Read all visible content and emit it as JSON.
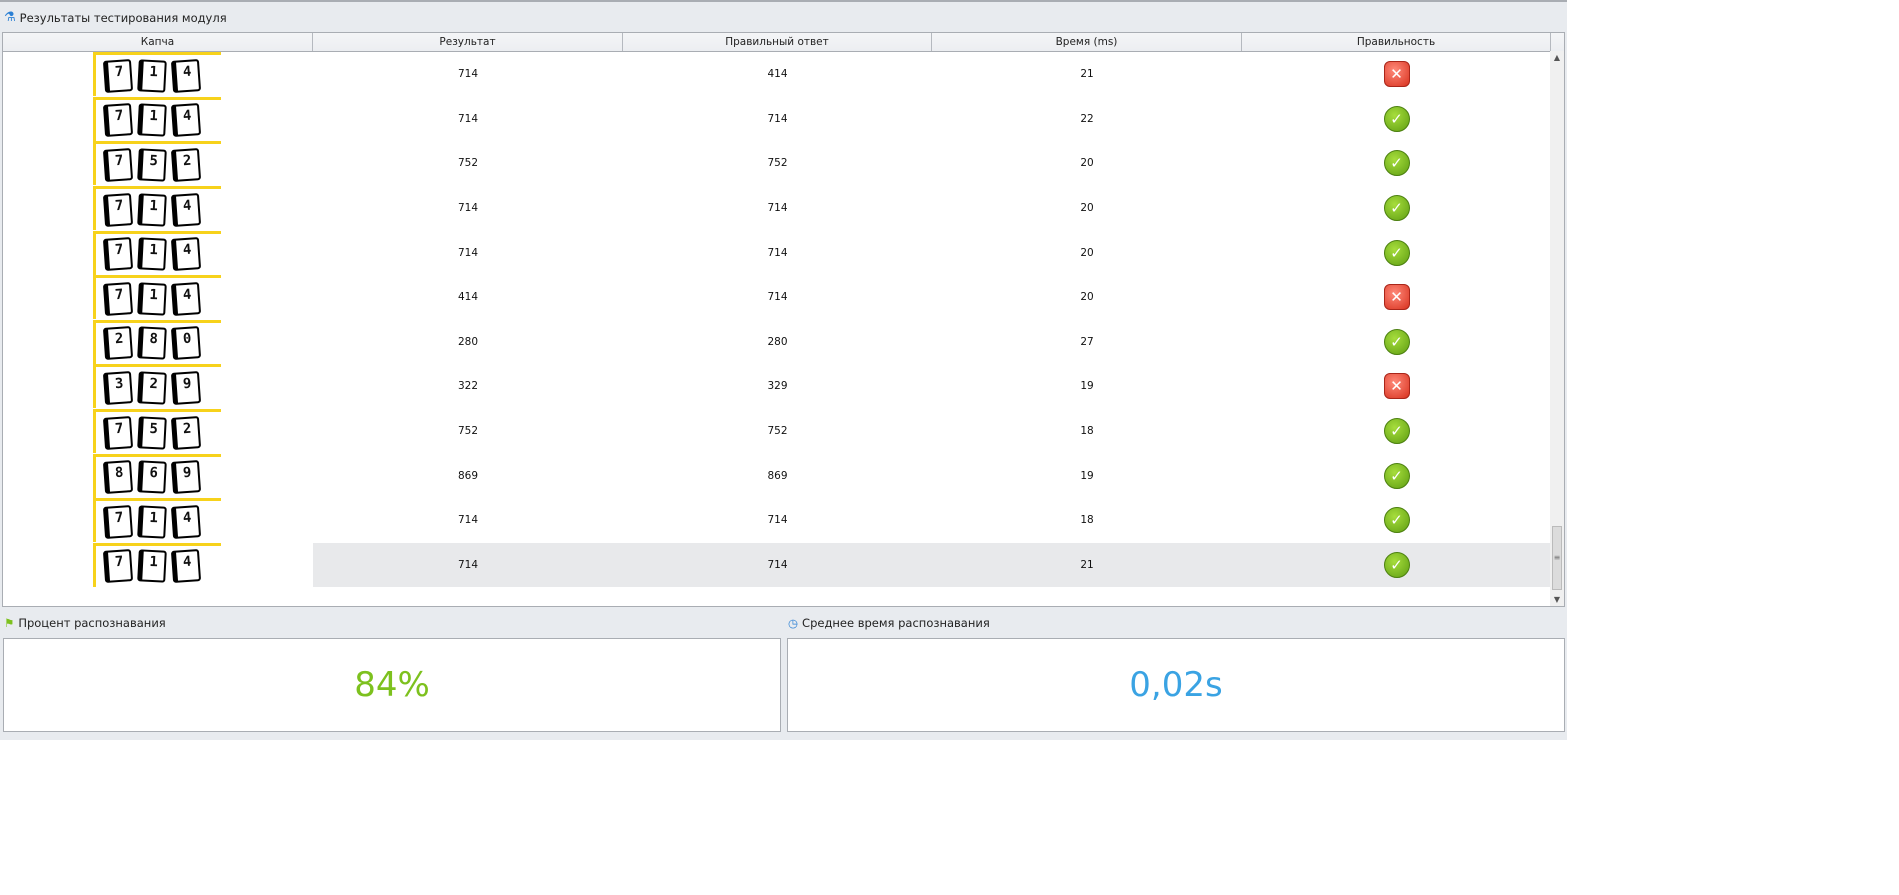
{
  "title": "Результаты тестирования модуля",
  "columns": [
    "Капча",
    "Результат",
    "Правильный ответ",
    "Время (ms)",
    "Правильность"
  ],
  "rows": [
    {
      "captcha": [
        "7",
        "1",
        "4"
      ],
      "result": "714",
      "answer": "414",
      "time": "21",
      "correct": false
    },
    {
      "captcha": [
        "7",
        "1",
        "4"
      ],
      "result": "714",
      "answer": "714",
      "time": "22",
      "correct": true
    },
    {
      "captcha": [
        "7",
        "5",
        "2"
      ],
      "result": "752",
      "answer": "752",
      "time": "20",
      "correct": true
    },
    {
      "captcha": [
        "7",
        "1",
        "4"
      ],
      "result": "714",
      "answer": "714",
      "time": "20",
      "correct": true
    },
    {
      "captcha": [
        "7",
        "1",
        "4"
      ],
      "result": "714",
      "answer": "714",
      "time": "20",
      "correct": true
    },
    {
      "captcha": [
        "7",
        "1",
        "4"
      ],
      "result": "414",
      "answer": "714",
      "time": "20",
      "correct": false
    },
    {
      "captcha": [
        "2",
        "8",
        "0"
      ],
      "result": "280",
      "answer": "280",
      "time": "27",
      "correct": true
    },
    {
      "captcha": [
        "3",
        "2",
        "9"
      ],
      "result": "322",
      "answer": "329",
      "time": "19",
      "correct": false
    },
    {
      "captcha": [
        "7",
        "5",
        "2"
      ],
      "result": "752",
      "answer": "752",
      "time": "18",
      "correct": true
    },
    {
      "captcha": [
        "8",
        "6",
        "9"
      ],
      "result": "869",
      "answer": "869",
      "time": "19",
      "correct": true
    },
    {
      "captcha": [
        "7",
        "1",
        "4"
      ],
      "result": "714",
      "answer": "714",
      "time": "18",
      "correct": true
    },
    {
      "captcha": [
        "7",
        "1",
        "4"
      ],
      "result": "714",
      "answer": "714",
      "time": "21",
      "correct": true
    }
  ],
  "selected_row": 11,
  "recognition": {
    "label": "Процент распознавания",
    "value": "84%",
    "color": "#7dc11e"
  },
  "avg_time": {
    "label": "Среднее время распознавания",
    "value": "0,02s",
    "color": "#3aa3e3"
  }
}
